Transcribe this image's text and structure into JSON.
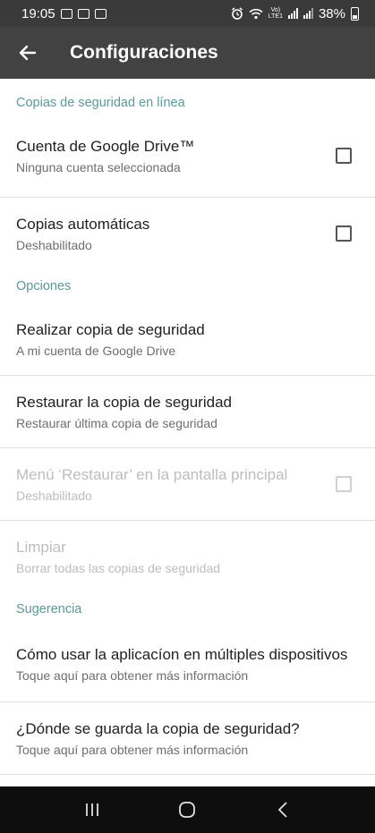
{
  "status_bar": {
    "time": "19:05",
    "battery_percent": "38%",
    "network_label_top": "Vo)",
    "network_label_bottom": "LTE1"
  },
  "app_bar": {
    "title": "Configuraciones",
    "back_icon": "arrow-left-icon"
  },
  "sections": {
    "online_backup": {
      "header": "Copias de seguridad en línea",
      "google_drive": {
        "title": "Cuenta de Google Drive™",
        "subtitle": "Ninguna cuenta seleccionada",
        "checked": false
      },
      "auto_backup": {
        "title": "Copias automáticas",
        "subtitle": "Deshabilitado",
        "checked": false
      }
    },
    "options": {
      "header": "Opciones",
      "backup": {
        "title": "Realizar copia de seguridad",
        "subtitle": "A mi cuenta de Google Drive"
      },
      "restore": {
        "title": "Restaurar la copia de seguridad",
        "subtitle": "Restaurar última copia de seguridad"
      },
      "restore_menu": {
        "title": "Menú ‘Restaurar’ en la pantalla principal",
        "subtitle": "Deshabilitado",
        "checked": false,
        "enabled": false
      },
      "clear": {
        "title": "Limpiar",
        "subtitle": "Borrar todas las copias de seguridad",
        "enabled": false
      }
    },
    "suggestion": {
      "header": "Sugerencia",
      "multi_device": {
        "title": "Cómo usar la aplicacíon en múltiples dispositivos",
        "subtitle": "Toque aquí para obtener más información"
      },
      "where_saved": {
        "title": "¿Dónde se guarda la copia de seguridad?",
        "subtitle": "Toque aquí para obtener más información"
      }
    }
  },
  "colors": {
    "status_bar": "#3a3a3a",
    "app_bar": "#424242",
    "section_header": "#5a9a98",
    "disabled_text": "#bdbdbd",
    "nav_bar": "#0e0e0e"
  },
  "nav_bar": {
    "recents_icon": "recents-icon",
    "home_icon": "home-icon",
    "back_icon": "back-chevron-icon"
  }
}
